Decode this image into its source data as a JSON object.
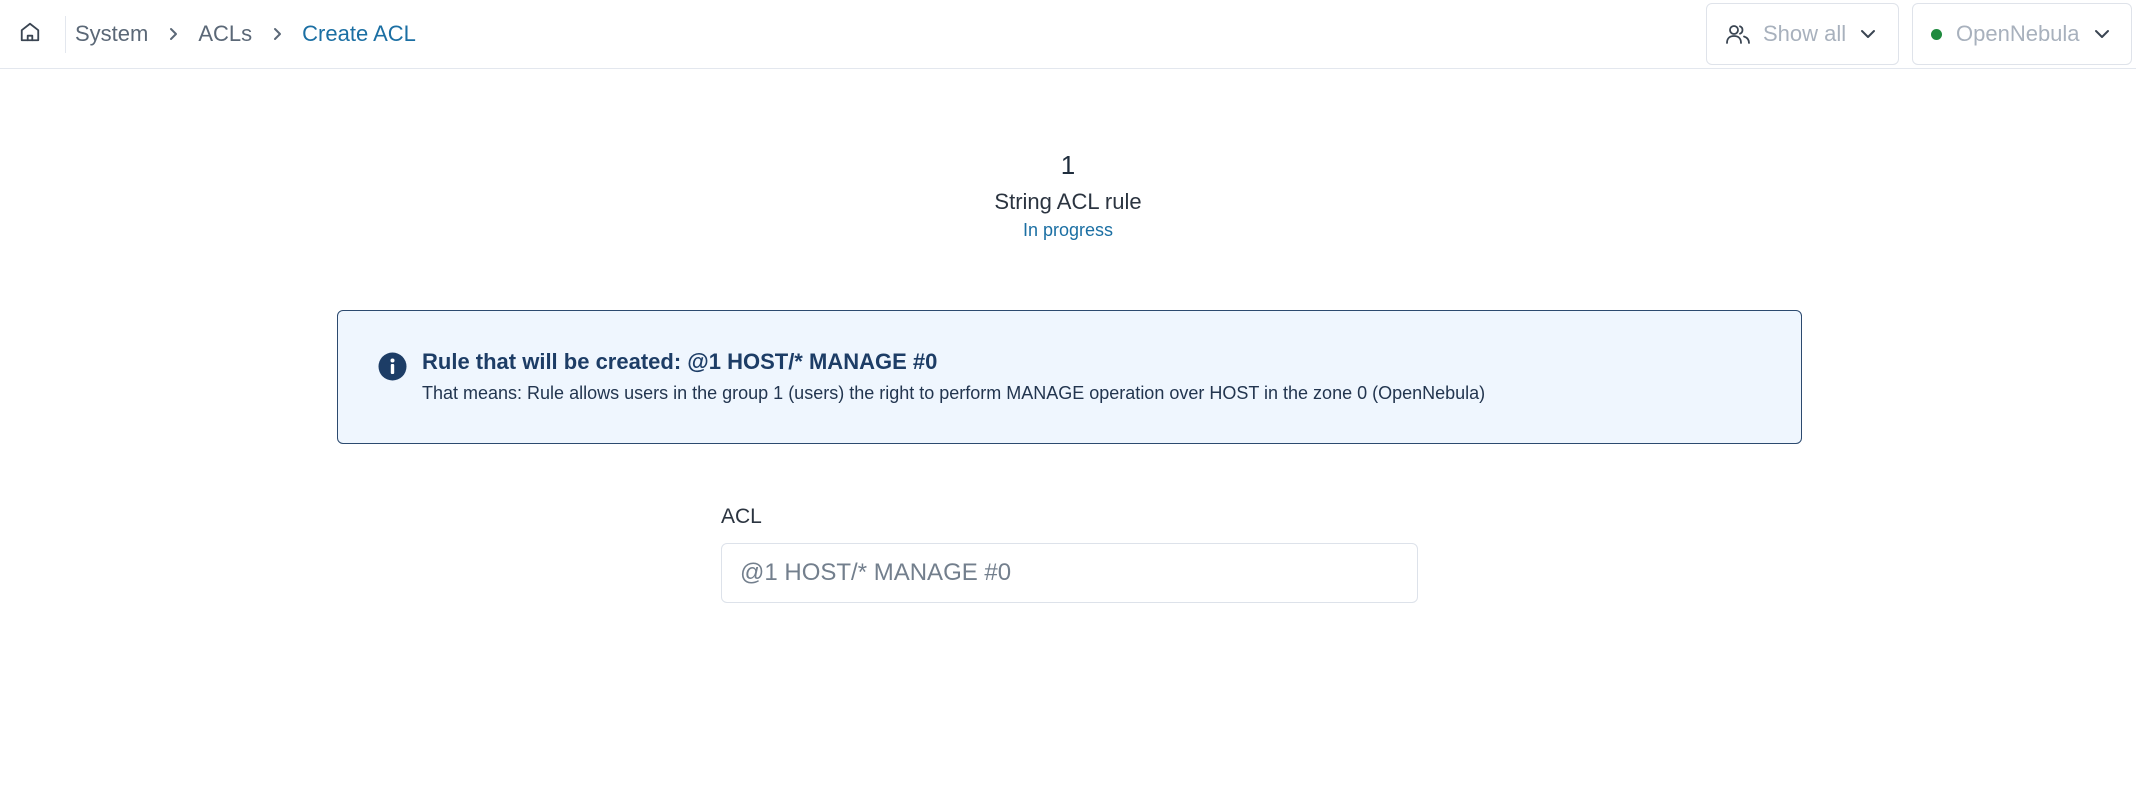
{
  "header": {
    "breadcrumb": {
      "items": [
        "System",
        "ACLs"
      ],
      "current": "Create ACL"
    },
    "group_filter": {
      "label": "Show all"
    },
    "zone": {
      "label": "OpenNebula",
      "status_color": "#1e8a3e"
    }
  },
  "stepper": {
    "step_number": "1",
    "step_label": "String ACL rule",
    "step_status": "In progress"
  },
  "alert": {
    "title": "Rule that will be created: @1 HOST/* MANAGE #0",
    "description": "That means: Rule allows users in the group 1 (users) the right to perform MANAGE operation over HOST in the zone 0 (OpenNebula)"
  },
  "form": {
    "acl_label": "ACL",
    "acl_placeholder": "@1 HOST/* MANAGE #0",
    "acl_value": ""
  },
  "colors": {
    "accent": "#1b6fa3",
    "alert_border": "#2c4a6f",
    "alert_background": "#eff6fe"
  }
}
